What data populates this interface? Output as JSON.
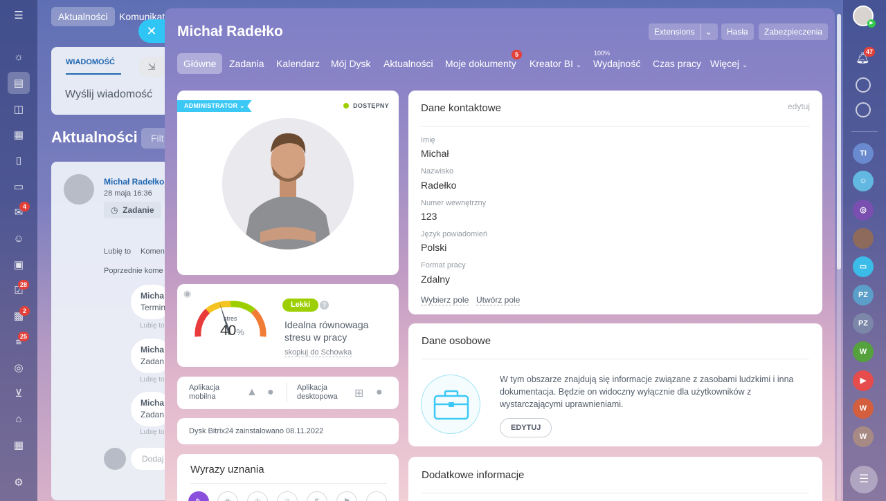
{
  "left_sidebar": {
    "badges": {
      "mail": "4",
      "tasks": "28",
      "contacts": "2",
      "filter": "25"
    },
    "icons": [
      "menu-icon",
      "feed-icon",
      "document-icon",
      "chat-icon",
      "calendar-icon",
      "file-icon",
      "drive-icon",
      "mail-icon",
      "group-icon",
      "video-icon",
      "tasks-icon",
      "contact-card-icon",
      "filter-icon",
      "target-icon",
      "cart-icon",
      "bank-icon",
      "schedule-icon",
      "settings-icon"
    ]
  },
  "background": {
    "tabs": [
      "Aktualności",
      "Komunikat"
    ],
    "compose": {
      "tab": "WIADOMOŚĆ",
      "placeholder": "Wyślij wiadomość"
    },
    "feed_title": "Aktualności",
    "filter": "Filt",
    "post": {
      "author": "Michał Radełko",
      "date": "28 maja 16:36",
      "tag": "Zadanie"
    },
    "actions": [
      "Lubię to",
      "Komen"
    ],
    "previous_comments": "Poprzednie kome",
    "comments": [
      {
        "author": "Micha",
        "text": "Termin",
        "like": "Lubię to"
      },
      {
        "author": "Micha",
        "text": "Zadan",
        "like": "Lubię to"
      },
      {
        "author": "Micha",
        "text": "Zadan",
        "like": "Lubię to"
      }
    ],
    "add_comment": "Dodaj"
  },
  "slider": {
    "title": "Michał Radełko",
    "header_buttons": {
      "extensions": "Extensions",
      "passwords": "Hasła",
      "security": "Zabezpieczenia"
    },
    "tabs": [
      {
        "label": "Główne"
      },
      {
        "label": "Zadania"
      },
      {
        "label": "Kalendarz"
      },
      {
        "label": "Mój Dysk"
      },
      {
        "label": "Aktualności"
      },
      {
        "label": "Moje dokumenty",
        "badge": "5"
      },
      {
        "label": "Kreator BI"
      },
      {
        "label": "Wydajność",
        "top": "100%"
      },
      {
        "label": "Czas pracy"
      },
      {
        "label": "Więcej"
      }
    ],
    "profile": {
      "role": "ADMINISTRATOR",
      "status": "DOSTĘPNY"
    },
    "stress": {
      "chip": "Lekki",
      "label": "stres",
      "value": 40,
      "value_text": "40",
      "unit": "%",
      "description": "Idealna równowaga stresu w pracy",
      "copy_link": "skopiuj do Schowka"
    },
    "apps": {
      "mobile": "Aplikacja mobilna",
      "desktop": "Aplikacja desktopowa"
    },
    "disk": "Dysk Bitrix24 zainstalowano 08.11.2022",
    "kudos": {
      "title": "Wyrazy uznania"
    },
    "contact": {
      "title": "Dane kontaktowe",
      "edit": "edytuj",
      "fields": [
        {
          "label": "Imię",
          "value": "Michał"
        },
        {
          "label": "Nazwisko",
          "value": "Radełko"
        },
        {
          "label": "Numer wewnętrzny",
          "value": "123"
        },
        {
          "label": "Język powiadomień",
          "value": "Polski"
        },
        {
          "label": "Format pracy",
          "value": "Zdalny"
        }
      ],
      "choose_field": "Wybierz pole",
      "create_field": "Utwórz pole"
    },
    "personal": {
      "title": "Dane osobowe",
      "text": "W tym obszarze znajdują się informacje związane z zasobami ludzkimi i inna dokumentacja. Będzie on widoczny wyłącznie dla użytkowników z wystarczającymi uprawnieniami.",
      "button": "EDYTUJ"
    },
    "additional": {
      "title": "Dodatkowe informacje"
    }
  },
  "right_sidebar": {
    "notifications_badge": "47",
    "avatars": [
      "TI",
      "PZ",
      "PZ",
      "W",
      "W",
      "W"
    ]
  },
  "colors": {
    "accent": "#2fc6f6",
    "badge": "#e3403a",
    "available": "#9dcf00",
    "chip": "#9dcf00"
  }
}
